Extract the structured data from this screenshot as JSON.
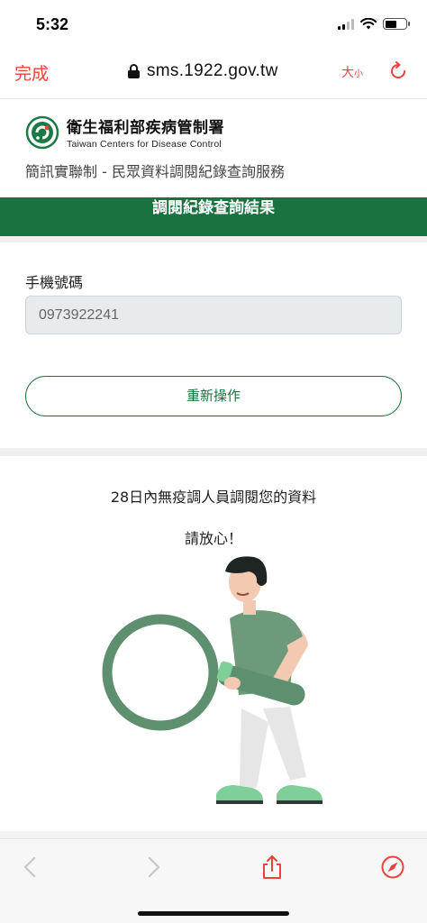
{
  "status_bar": {
    "time": "5:32",
    "battery_level": 0.55
  },
  "browser": {
    "done_label": "完成",
    "url": "sms.1922.gov.tw",
    "textsize_large": "大",
    "textsize_small": "小"
  },
  "header": {
    "brand_main": "衛生福利部疾病管制署",
    "brand_sub": "Taiwan Centers for Disease Control",
    "service_title": "簡訊實聯制 - 民眾資料調閱紀錄查詢服務"
  },
  "result": {
    "banner_title": "調閱紀錄查詢結果",
    "phone_label": "手機號碼",
    "phone_value": "0973922241",
    "restart_button": "重新操作"
  },
  "message": {
    "line1": "28日內無疫調人員調閱您的資料",
    "line2": "請放心！"
  },
  "colors": {
    "accent_red": "#e8453c",
    "brand_green": "#19723f",
    "illustration_green": "#5e8f6e"
  },
  "icons": [
    "lock-icon",
    "reload-icon",
    "back-icon",
    "forward-icon",
    "share-icon",
    "compass-icon",
    "cdc-logo",
    "magnifier-person-illustration"
  ]
}
